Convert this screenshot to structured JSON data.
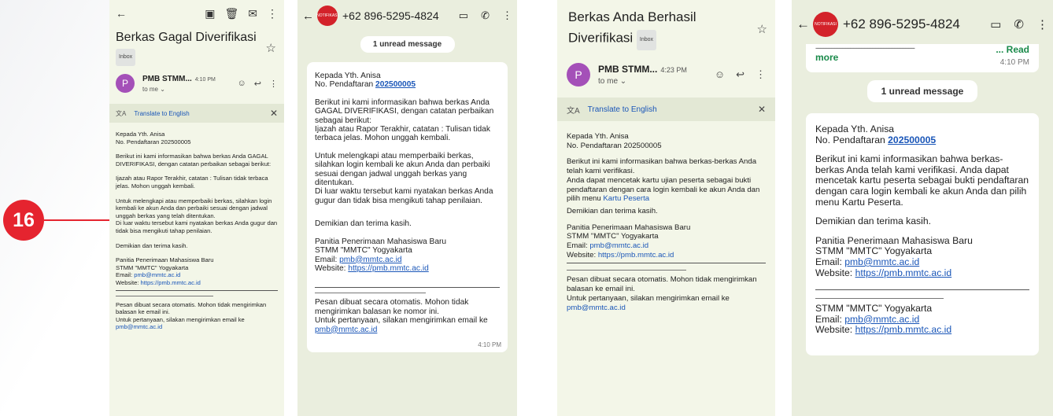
{
  "badge": {
    "number": "16"
  },
  "gmail_fail": {
    "title": "Berkas Gagal Diverifikasi",
    "inbox": "Inbox",
    "sender": "PMB STMM...",
    "time": "4:10 PM",
    "to": "to me ⌄",
    "avatar": "P",
    "translate": "Translate to English",
    "body": [
      "Kepada Yth. Anisa\nNo. Pendaftaran 202500005",
      "Berikut ini kami informasikan bahwa berkas Anda GAGAL DIVERIFIKASI, dengan catatan perbaikan sebagai berikut:",
      "Ijazah atau Rapor Terakhir, catatan : Tulisan tidak terbaca jelas. Mohon unggah kembali.",
      "Untuk melengkapi atau memperbaiki berkas, silahkan login kembali ke akun Anda dan perbaiki sesuai dengan jadwal unggah berkas yang telah ditentukan.\nDi luar waktu tersebut kami nyatakan berkas Anda gugur dan tidak bisa mengikuti tahap penilaian.",
      "Demikian dan terima kasih.",
      "Panitia Penerimaan Mahasiswa Baru\nSTMM \"MMTC\" Yogyakarta"
    ],
    "email_label": "Email: ",
    "email": "pmb@mmtc.ac.id",
    "website_label": "Website: ",
    "website": "https://pmb.mmtc.ac.id",
    "footer": "Pesan dibuat secara otomatis. Mohon tidak mengirimkan balasan ke email ini.\nUntuk pertanyaan, silakan mengirimkan email ke ",
    "footer_email": "pmb@mmtc.ac.id"
  },
  "wa_fail": {
    "phone": "+62 896-5295-4824",
    "logo_text": "NOTIFIKASI",
    "unread": "1 unread message",
    "greeting": "Kepada Yth. Anisa",
    "reg_label": "No. Pendaftaran ",
    "reg_no": "202500005",
    "body": [
      "Berikut ini kami informasikan bahwa berkas Anda GAGAL DIVERIFIKASI, dengan catatan perbaikan sebagai berikut:\nIjazah atau Rapor Terakhir, catatan : Tulisan tidak terbaca jelas. Mohon unggah kembali.",
      "Untuk melengkapi atau memperbaiki berkas, silahkan login kembali ke akun Anda dan perbaiki sesuai dengan jadwal unggah berkas yang ditentukan.\nDi luar waktu tersebut kami nyatakan berkas Anda gugur dan tidak bisa mengikuti tahap penilaian.",
      "Demikian dan terima kasih.",
      "Panitia Penerimaan Mahasiswa Baru\nSTMM \"MMTC\" Yogyakarta"
    ],
    "email_label": "Email: ",
    "email": "pmb@mmtc.ac.id",
    "website_label": "Website: ",
    "website": "https://pmb.mmtc.ac.id",
    "footer": "Pesan dibuat secara otomatis. Mohon tidak mengirimkan balasan ke nomor ini.\nUntuk pertanyaan, silakan mengirimkan email ke ",
    "footer_email": "pmb@mmtc.ac.id",
    "time": "4:10 PM"
  },
  "gmail_ok": {
    "title": "Berkas Anda Berhasil Diverifikasi",
    "inbox": "Inbox",
    "sender": "PMB STMM...",
    "time": "4:23 PM",
    "to": "to me ⌄",
    "avatar": "P",
    "translate": "Translate to English",
    "body": [
      "Kepada Yth. Anisa\nNo. Pendaftaran 202500005",
      "Berikut ini kami informasikan bahwa berkas-berkas Anda telah kami verifikasi.\nAnda dapat mencetak kartu ujian peserta sebagai bukti pendaftaran dengan cara login kembali ke akun Anda dan pilih menu ",
      "Demikian dan terima kasih.",
      "Panitia Penerimaan Mahasiswa Baru\nSTMM \"MMTC\" Yogyakarta"
    ],
    "menu_link": "Kartu Peserta",
    "email_label": "Email: ",
    "email": "pmb@mmtc.ac.id",
    "website_label": "Website: ",
    "website": "https://pmb.mmtc.ac.id",
    "footer": "Pesan dibuat secara otomatis. Mohon tidak mengirimkan balasan ke email ini.\nUntuk pertanyaan, silakan mengirimkan email ke ",
    "footer_email": "pmb@mmtc.ac.id"
  },
  "wa_ok": {
    "phone": "+62 896-5295-4824",
    "logo_text": "NOTIFIKASI",
    "prev_read": "... Read",
    "prev_more": "more",
    "prev_time": "4:10 PM",
    "unread": "1 unread message",
    "greeting": "Kepada Yth. Anisa",
    "reg_label": "No. Pendaftaran ",
    "reg_no": "202500005",
    "body": [
      "Berikut ini kami informasikan bahwa berkas-berkas Anda telah kami verifikasi. Anda dapat mencetak kartu peserta sebagai bukti pendaftaran dengan cara login kembali ke akun Anda dan pilih menu Kartu Peserta.",
      "Demikian dan terima kasih.",
      "Panitia Penerimaan Mahasiswa Baru\nSTMM \"MMTC\" Yogyakarta"
    ],
    "email_label": "Email: ",
    "email": "pmb@mmtc.ac.id",
    "website_label": "Website: ",
    "website": "https://pmb.mmtc.ac.id",
    "sig": "STMM \"MMTC\" Yogyakarta"
  }
}
